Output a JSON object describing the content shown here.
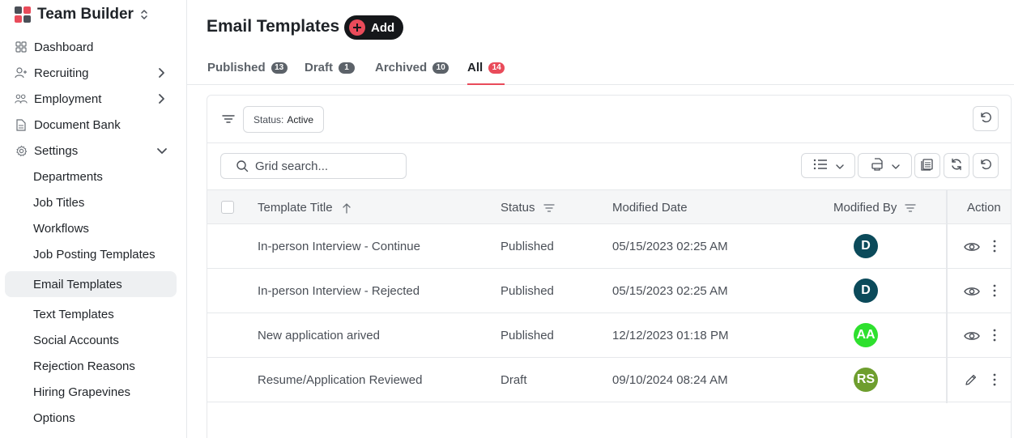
{
  "brand": {
    "name": "Team Builder"
  },
  "sidebar": {
    "items": [
      {
        "label": "Dashboard",
        "icon": "grid-icon"
      },
      {
        "label": "Recruiting",
        "icon": "user-plus-icon"
      },
      {
        "label": "Employment",
        "icon": "users-icon"
      },
      {
        "label": "Document Bank",
        "icon": "document-icon"
      },
      {
        "label": "Settings",
        "icon": "gear-icon"
      }
    ],
    "settings_sub": [
      "Departments",
      "Job Titles",
      "Workflows",
      "Job Posting Templates",
      "Email Templates",
      "Text Templates",
      "Social Accounts",
      "Rejection Reasons",
      "Hiring Grapevines",
      "Options"
    ]
  },
  "header": {
    "title": "Email Templates",
    "add_label": "Add"
  },
  "tabs": [
    {
      "label": "Published",
      "count": "13"
    },
    {
      "label": "Draft",
      "count": "1"
    },
    {
      "label": "Archived",
      "count": "10"
    },
    {
      "label": "All",
      "count": "14"
    }
  ],
  "filter": {
    "label": "Status:",
    "value": "Active"
  },
  "search": {
    "placeholder": "Grid search..."
  },
  "grid": {
    "columns": [
      "Template Title",
      "Status",
      "Modified Date",
      "Modified By",
      "Action"
    ],
    "rows": [
      {
        "title": "In-person Interview - Continue",
        "status": "Published",
        "date": "05/15/2023 02:25 AM",
        "by": "D",
        "color": "#0b4a5a",
        "action": "view"
      },
      {
        "title": "In-person Interview - Rejected",
        "status": "Published",
        "date": "05/15/2023 02:25 AM",
        "by": "D",
        "color": "#0b4a5a",
        "action": "view"
      },
      {
        "title": "New application arived",
        "status": "Published",
        "date": "12/12/2023 01:18 PM",
        "by": "AA",
        "color": "#2ee02e",
        "action": "view"
      },
      {
        "title": "Resume/Application Reviewed",
        "status": "Draft",
        "date": "09/10/2024 08:24 AM",
        "by": "RS",
        "color": "#6e9e2e",
        "action": "edit"
      }
    ]
  },
  "colors": {
    "accent": "#e94b5a",
    "dark": "#15171a"
  }
}
